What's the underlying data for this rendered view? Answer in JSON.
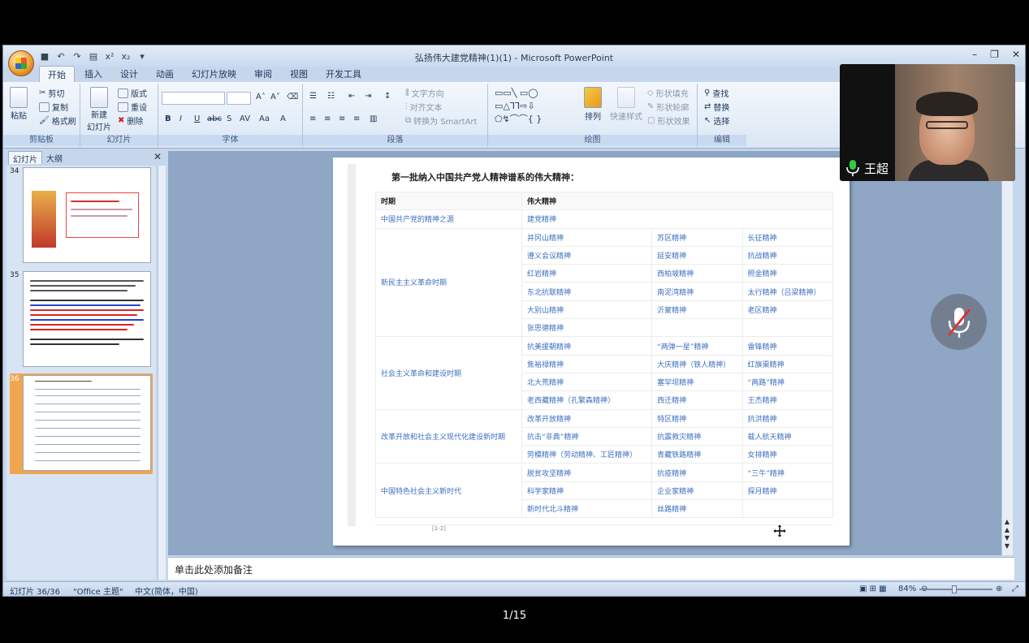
{
  "window": {
    "title": "弘扬伟大建党精神(1)(1) - Microsoft PowerPoint"
  },
  "ribbon": {
    "tabs": [
      "开始",
      "插入",
      "设计",
      "动画",
      "幻灯片放映",
      "审阅",
      "视图",
      "开发工具"
    ],
    "clipboard": {
      "paste": "粘贴",
      "cut": "剪切",
      "copy": "复制",
      "format_painter": "格式刷",
      "label": "剪贴板"
    },
    "slides": {
      "new_slide_line1": "新建",
      "new_slide_line2": "幻灯片",
      "layout": "版式",
      "reset": "重设",
      "delete": "删除",
      "label": "幻灯片"
    },
    "font": {
      "label": "字体"
    },
    "paragraph": {
      "text_direction": "文字方向",
      "align_text": "对齐文本",
      "smartart": "转换为 SmartArt",
      "label": "段落"
    },
    "drawing": {
      "arrange": "排列",
      "quick_styles": "快速样式",
      "shape_fill": "形状填充",
      "shape_outline": "形状轮廓",
      "shape_effects": "形状效果",
      "label": "绘图"
    },
    "editing": {
      "find": "查找",
      "replace": "替换",
      "select": "选择",
      "label": "编辑"
    }
  },
  "left_pane": {
    "tab_slides": "幻灯片",
    "tab_outline": "大纲",
    "thumbnails": [
      {
        "number": "34"
      },
      {
        "number": "35"
      },
      {
        "number": "36"
      }
    ]
  },
  "slide": {
    "heading": "第一批纳入中国共产党人精神谱系的伟大精神：",
    "header_period": "时期",
    "header_spirit": "伟大精神",
    "footer_text": "[1-2]",
    "periods": [
      {
        "name": "中国共产党的精神之源",
        "rows": [
          [
            "建党精神"
          ]
        ]
      },
      {
        "name": "新民主主义革命时期",
        "rows": [
          [
            "井冈山精神",
            "苏区精神",
            "长征精神"
          ],
          [
            "遵义会议精神",
            "延安精神",
            "抗战精神"
          ],
          [
            "红岩精神",
            "西柏坡精神",
            "照金精神"
          ],
          [
            "东北抗联精神",
            "南泥湾精神",
            "太行精神（吕梁精神）"
          ],
          [
            "大别山精神",
            "沂蒙精神",
            "老区精神"
          ],
          [
            "张思德精神",
            "",
            ""
          ]
        ]
      },
      {
        "name": "社会主义革命和建设时期",
        "rows": [
          [
            "抗美援朝精神",
            "“两弹一星”精神",
            "雷锋精神"
          ],
          [
            "焦裕禄精神",
            "大庆精神（铁人精神）",
            "红旗渠精神"
          ],
          [
            "北大荒精神",
            "塞罕坝精神",
            "“两路”精神"
          ],
          [
            "老西藏精神（孔繁森精神）",
            "西迁精神",
            "王杰精神"
          ]
        ]
      },
      {
        "name": "改革开放和社会主义现代化建设新时期",
        "rows": [
          [
            "改革开放精神",
            "特区精神",
            "抗洪精神"
          ],
          [
            "抗击“非典”精神",
            "抗震救灾精神",
            "载人航天精神"
          ],
          [
            "劳模精神（劳动精神、工匠精神）",
            "青藏铁路精神",
            "女排精神"
          ]
        ]
      },
      {
        "name": "中国特色社会主义新时代",
        "rows": [
          [
            "脱贫攻坚精神",
            "抗疫精神",
            "“三牛”精神"
          ],
          [
            "科学家精神",
            "企业家精神",
            "探月精神"
          ],
          [
            "新时代北斗精神",
            "丝路精神",
            ""
          ]
        ]
      }
    ]
  },
  "notes": {
    "placeholder": "单击此处添加备注"
  },
  "statusbar": {
    "slide_pos": "幻灯片 36/36",
    "theme": "\"Office 主题\"",
    "language": "中文(简体，中国)",
    "zoom": "84%"
  },
  "video": {
    "participant_name": "王超"
  },
  "page_counter": "1/15",
  "colors": {
    "table_text": "#3d6fbf",
    "thumb_selected": "#f0a64e",
    "ribbon_bg": "#dbe7f5"
  }
}
